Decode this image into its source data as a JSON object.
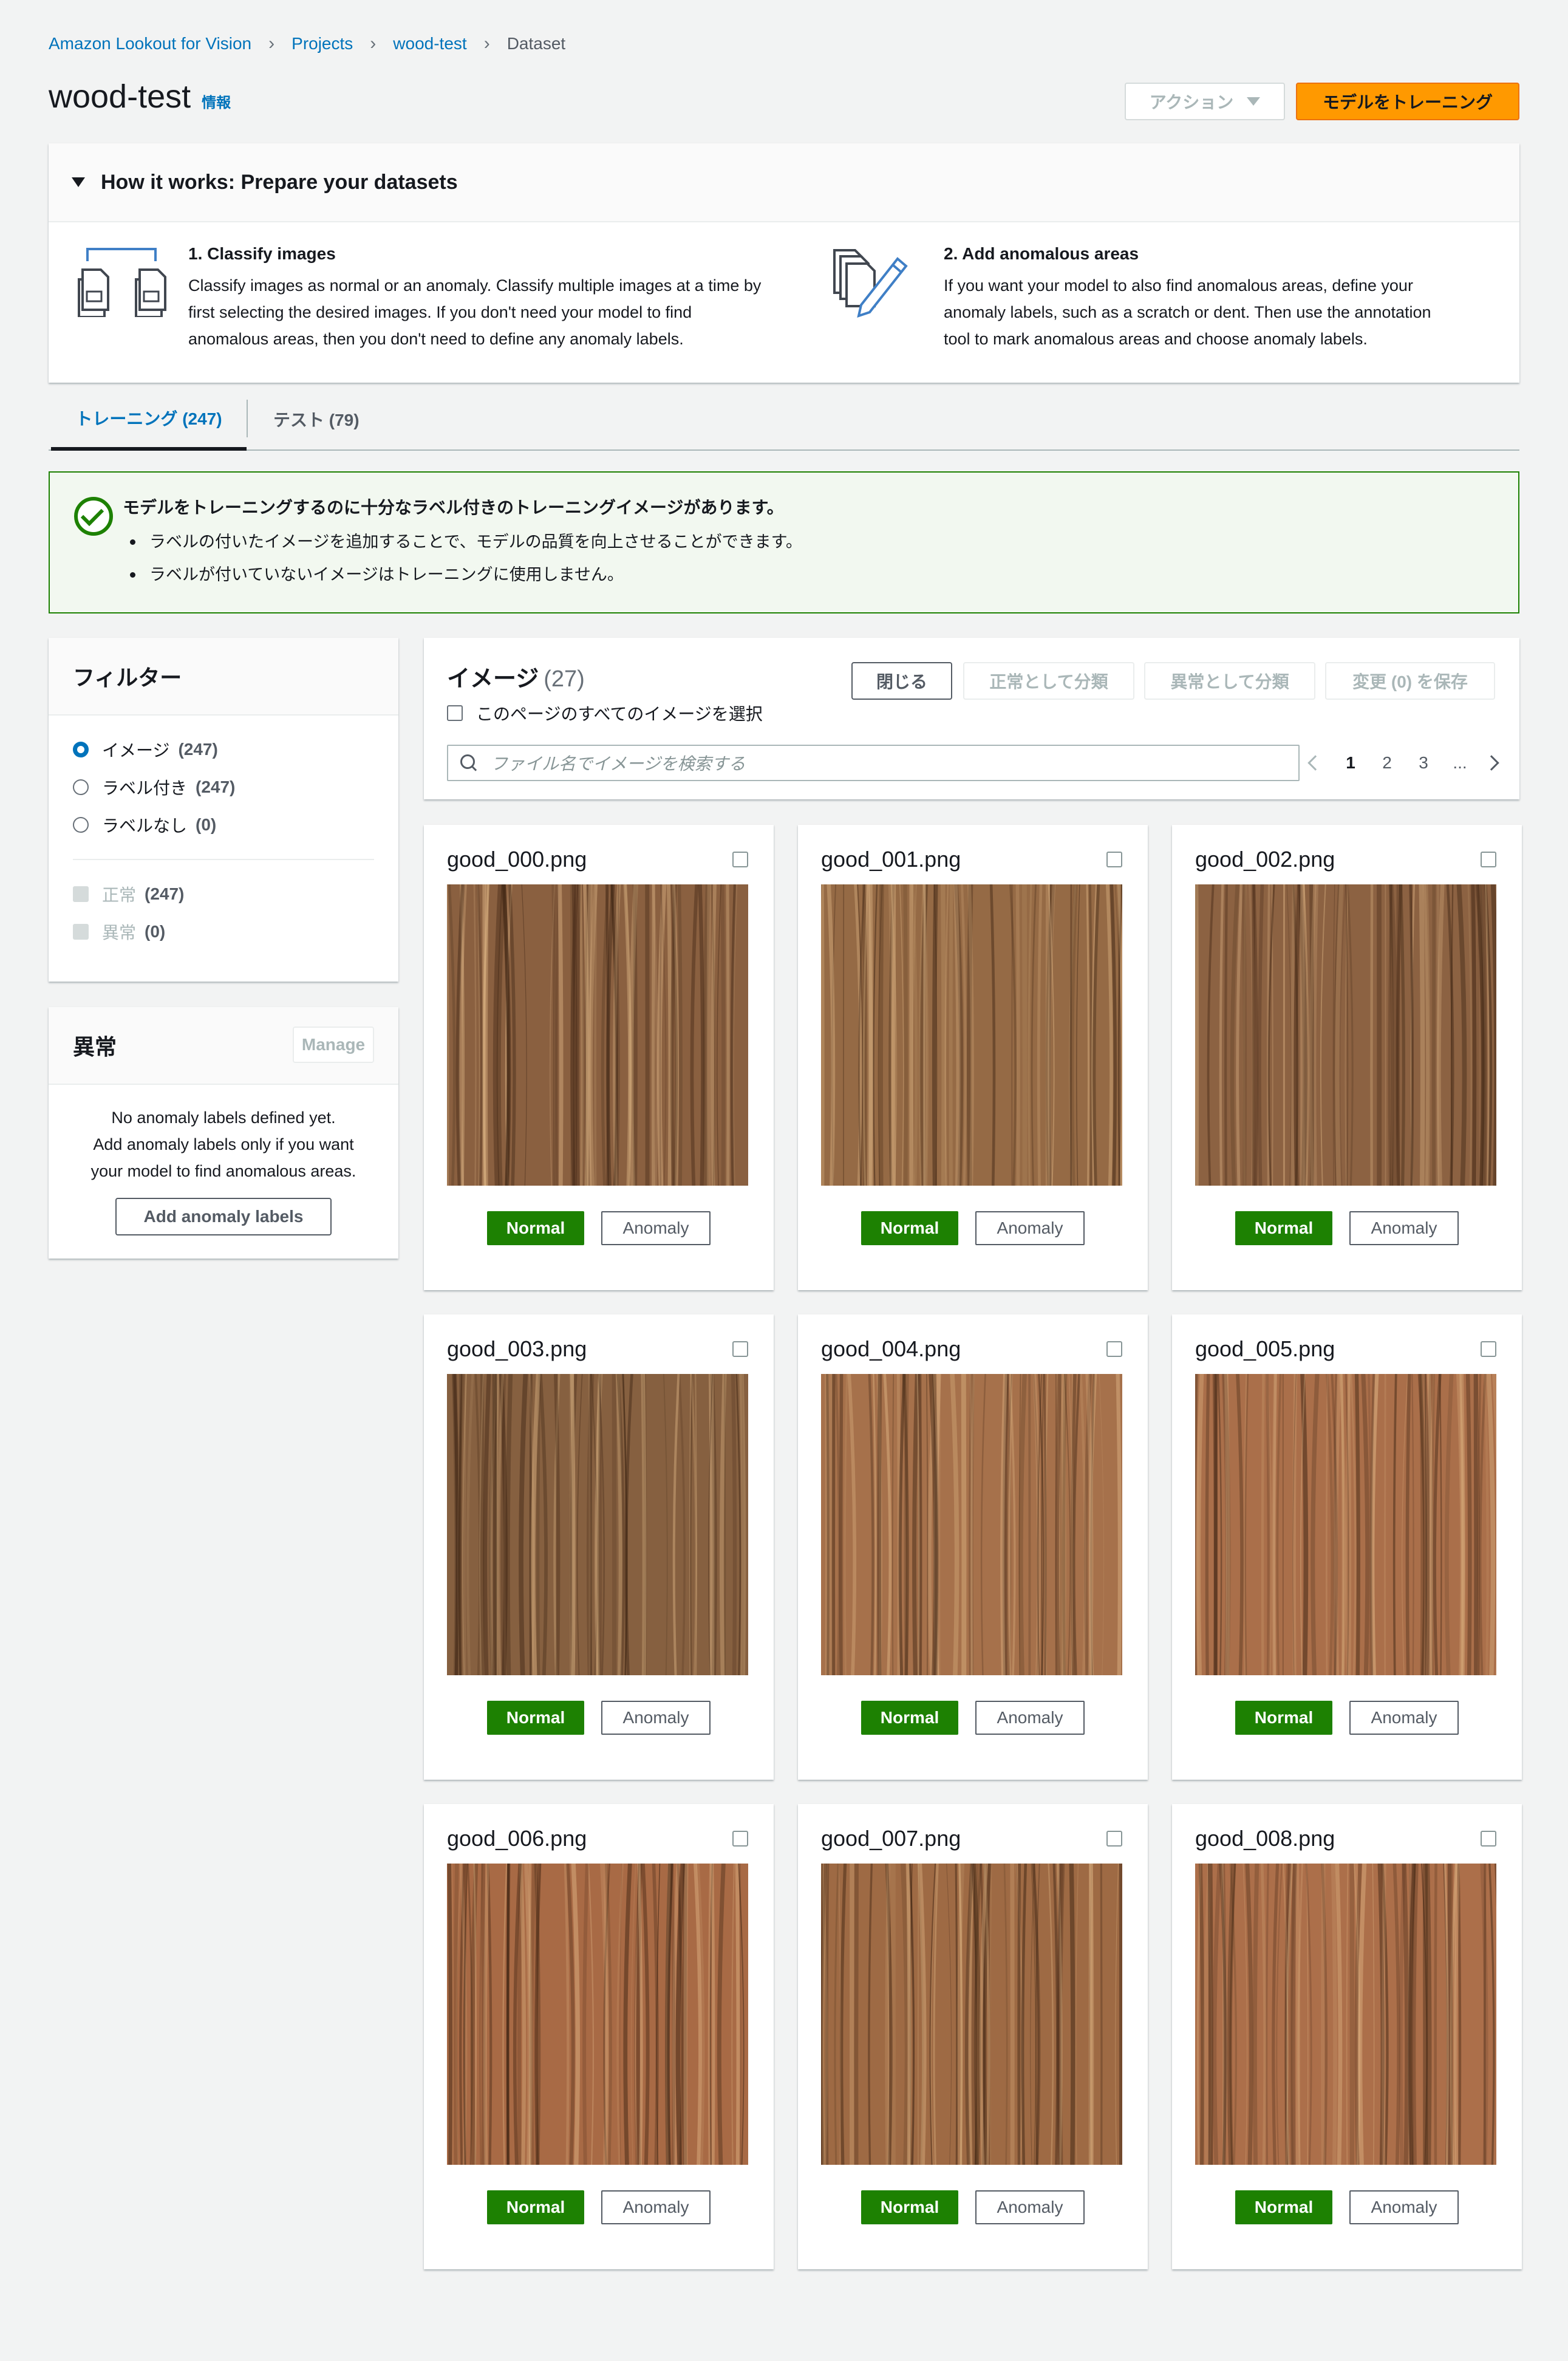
{
  "breadcrumb": [
    "Amazon Lookout for Vision",
    "Projects",
    "wood-test",
    "Dataset"
  ],
  "page": {
    "title": "wood-test",
    "info_link": "情報"
  },
  "header_buttons": {
    "actions": "アクション",
    "train": "モデルをトレーニング"
  },
  "how_it_works": {
    "title": "How it works: Prepare your datasets",
    "steps": [
      {
        "icon": "classify-images-icon",
        "title": "1. Classify images",
        "lines": [
          "Classify images as normal or an anomaly. Classify multiple images at a time by",
          "first selecting the desired images. If you don't need your model to find",
          "anomalous areas, then you don't need to define any anomaly labels."
        ]
      },
      {
        "icon": "annotate-images-icon",
        "title": "2. Add anomalous areas",
        "lines": [
          "If you want your model to also find anomalous areas, define your",
          "anomaly labels, such as a scratch or dent. Then use the annotation",
          "tool to mark anomalous areas and choose anomaly labels."
        ]
      }
    ]
  },
  "tabs": [
    {
      "label": "トレーニング (247)",
      "active": true
    },
    {
      "label": "テスト (79)",
      "active": false
    }
  ],
  "alert": {
    "title": "モデルをトレーニングするのに十分なラベル付きのトレーニングイメージがあります。",
    "items": [
      "ラベルの付いたイメージを追加することで、モデルの品質を向上させることができます。",
      "ラベルが付いていないイメージはトレーニングに使用しません。"
    ]
  },
  "filter": {
    "title": "フィルター",
    "radios": [
      {
        "label": "イメージ",
        "count": "(247)",
        "selected": true
      },
      {
        "label": "ラベル付き",
        "count": "(247)",
        "selected": false
      },
      {
        "label": "ラベルなし",
        "count": "(0)",
        "selected": false
      }
    ],
    "checkboxes": [
      {
        "label": "正常",
        "count": "(247)"
      },
      {
        "label": "異常",
        "count": "(0)"
      }
    ]
  },
  "anomaly": {
    "title": "異常",
    "manage": "Manage",
    "empty_lines": [
      "No anomaly labels defined yet.",
      "Add anomaly labels only if you want",
      "your model to find anomalous areas."
    ],
    "add_button": "Add anomaly labels"
  },
  "images_panel": {
    "title": "イメージ",
    "count": "(27)",
    "close": "閉じる",
    "classify_normal": "正常として分類",
    "classify_anomaly": "異常として分類",
    "save_changes": "変更 (0) を保存",
    "select_all": "このページのすべてのイメージを選択",
    "search_placeholder": "ファイル名でイメージを検索する",
    "pages": [
      "1",
      "2",
      "3",
      "..."
    ],
    "current_page": "1"
  },
  "images": [
    {
      "name": "good_000.png",
      "normal": "Normal",
      "anomaly": "Anomaly",
      "tone": "#8a6040"
    },
    {
      "name": "good_001.png",
      "normal": "Normal",
      "anomaly": "Anomaly",
      "tone": "#956a45"
    },
    {
      "name": "good_002.png",
      "normal": "Normal",
      "anomaly": "Anomaly",
      "tone": "#8c6242"
    },
    {
      "name": "good_003.png",
      "normal": "Normal",
      "anomaly": "Anomaly",
      "tone": "#866040"
    },
    {
      "name": "good_004.png",
      "normal": "Normal",
      "anomaly": "Anomaly",
      "tone": "#a6714b"
    },
    {
      "name": "good_005.png",
      "normal": "Normal",
      "anomaly": "Anomaly",
      "tone": "#aa6f4a"
    },
    {
      "name": "good_006.png",
      "normal": "Normal",
      "anomaly": "Anomaly",
      "tone": "#a86a45"
    },
    {
      "name": "good_007.png",
      "normal": "Normal",
      "anomaly": "Anomaly",
      "tone": "#9e6a44"
    },
    {
      "name": "good_008.png",
      "normal": "Normal",
      "anomaly": "Anomaly",
      "tone": "#ac6f4a"
    }
  ],
  "colors": {
    "link": "#0073bb",
    "primary": "#ff9900",
    "success": "#1d8102"
  }
}
